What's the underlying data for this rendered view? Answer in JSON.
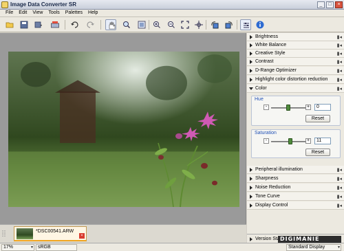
{
  "window": {
    "title": "Image Data Converter SR",
    "minimize": "_",
    "maximize": "□",
    "close": "×"
  },
  "menu": [
    "File",
    "Edit",
    "View",
    "Tools",
    "Palettes",
    "Help"
  ],
  "toolbar": {
    "icons": [
      "open-folder-icon",
      "save-disk-icon",
      "save-dropdown-icon",
      "convert-icon",
      "undo-icon",
      "redo-icon",
      "hand-tool-icon",
      "loupe-icon",
      "fit-icon",
      "zoom-in-icon",
      "zoom-out-icon",
      "fullscreen-icon",
      "crosshair-icon",
      "rotate-left-icon",
      "rotate-right-icon",
      "adjust-icon",
      "info-icon"
    ]
  },
  "panel": {
    "sections_top": [
      {
        "label": "Brightness",
        "open": false
      },
      {
        "label": "White Balance",
        "open": false
      },
      {
        "label": "Creative Style",
        "open": false
      },
      {
        "label": "Contrast",
        "open": false
      },
      {
        "label": "D-Range Optimizer",
        "open": false
      },
      {
        "label": "Highlight color distortion reduction",
        "open": false
      },
      {
        "label": "Color",
        "open": true
      }
    ],
    "hue": {
      "title": "Hue",
      "value": "0",
      "minus": "-",
      "plus": "+",
      "reset": "Reset",
      "level": 0.5
    },
    "saturation": {
      "title": "Saturation",
      "value": "11",
      "minus": "-",
      "plus": "+",
      "reset": "Reset",
      "level": 0.55
    },
    "sections_bottom": [
      {
        "label": "Peripheral illumination"
      },
      {
        "label": "Sharpness"
      },
      {
        "label": "Noise Reduction"
      },
      {
        "label": "Tone Curve"
      },
      {
        "label": "Display Control"
      }
    ],
    "pin_glyph": "▮◂"
  },
  "filmstrip": {
    "filename": "*DSC00541.ARW",
    "close": "×"
  },
  "version_stack": {
    "label": "Version Stack"
  },
  "status": {
    "zoom": "17%",
    "colorspace": "sRGB",
    "display": "Standard Display",
    "dd": "▾"
  },
  "watermark": "DIGIMANIE"
}
